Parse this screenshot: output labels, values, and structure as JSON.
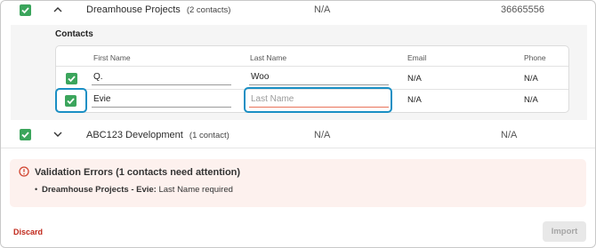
{
  "accounts": [
    {
      "name": "Dreamhouse Projects",
      "contact_count": "(2 contacts)",
      "col2": "N/A",
      "col3": "36665556",
      "expanded": true
    },
    {
      "name": "ABC123 Development",
      "contact_count": "(1 contact)",
      "col2": "N/A",
      "col3": "N/A",
      "expanded": false
    }
  ],
  "contacts_section": {
    "title": "Contacts",
    "headers": {
      "first_name": "First Name",
      "last_name": "Last Name",
      "email": "Email",
      "phone": "Phone"
    },
    "rows": [
      {
        "first_name": "Q.",
        "last_name": "Woo",
        "email": "N/A",
        "phone": "N/A",
        "last_name_placeholder": ""
      },
      {
        "first_name": "Evie",
        "last_name": "",
        "email": "N/A",
        "phone": "N/A",
        "last_name_placeholder": "Last Name"
      }
    ]
  },
  "validation": {
    "title": "Validation Errors (1 contacts need attention)",
    "items": [
      {
        "label": "Dreamhouse Projects - Evie:",
        "message": "Last Name required"
      }
    ]
  },
  "footer": {
    "discard_label": "Discard",
    "import_label": "Import"
  },
  "colors": {
    "checkbox": "#3ba55c",
    "focus": "#1a8fc4",
    "error_underline": "#e8735a",
    "discard": "#c0281b"
  }
}
